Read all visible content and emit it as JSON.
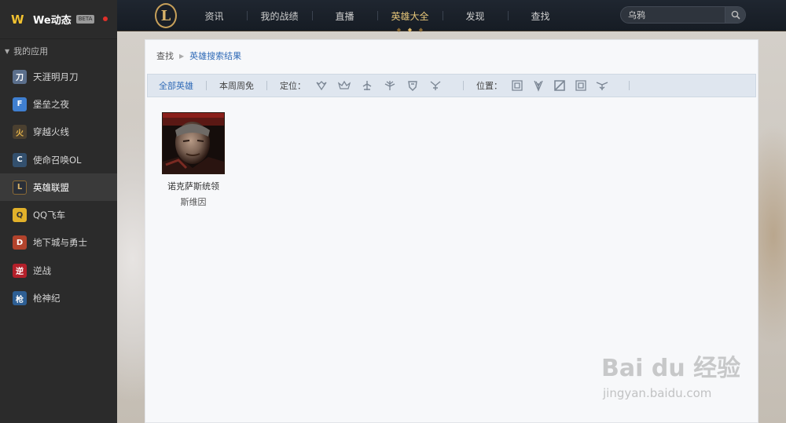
{
  "sidebar": {
    "app_name": "We动态",
    "beta_badge": "BETA",
    "section_label": "我的应用",
    "items": [
      {
        "label": "天涯明月刀",
        "icon": "tianya-icon",
        "color": "#5b6f8c",
        "glyph": "刀"
      },
      {
        "label": "堡垒之夜",
        "icon": "fortnite-icon",
        "color": "#3f7fd0",
        "glyph": "F"
      },
      {
        "label": "穿越火线",
        "icon": "crossfire-icon",
        "color": "#4b4030",
        "glyph": "火"
      },
      {
        "label": "使命召唤OL",
        "icon": "cod-icon",
        "color": "#33506e",
        "glyph": "C"
      },
      {
        "label": "英雄联盟",
        "icon": "lol-icon",
        "color": "#2a2f38",
        "glyph": "L"
      },
      {
        "label": "QQ飞车",
        "icon": "qqspeed-icon",
        "color": "#e2b12a",
        "glyph": "Q"
      },
      {
        "label": "地下城与勇士",
        "icon": "dnf-icon",
        "color": "#b2432c",
        "glyph": "D"
      },
      {
        "label": "逆战",
        "icon": "nizhan-icon",
        "color": "#b3202a",
        "glyph": "逆"
      },
      {
        "label": "枪神纪",
        "icon": "qiangshen-icon",
        "color": "#2e5f94",
        "glyph": "枪"
      }
    ],
    "active_index": 4
  },
  "topnav": {
    "logo_letter": "L",
    "items": [
      "资讯",
      "我的战绩",
      "直播",
      "英雄大全",
      "发现",
      "查找"
    ],
    "active_index": 3,
    "search": {
      "value": "乌鸦",
      "placeholder": "乌鸦"
    }
  },
  "breadcrumb": {
    "root": "查找",
    "current": "英雄搜索结果"
  },
  "filters": {
    "tabs": [
      "全部英雄",
      "本周周免"
    ],
    "role_label": "定位：",
    "role_icons": [
      "assassin-icon",
      "mage-icon",
      "tank-icon",
      "marksman-icon",
      "fighter-icon",
      "support-icon"
    ],
    "position_label": "位置：",
    "position_icons": [
      "top-lane-icon",
      "jungle-icon",
      "mid-lane-icon",
      "bot-lane-icon",
      "support-lane-icon"
    ]
  },
  "results": [
    {
      "name": "诺克萨斯统领",
      "title": "斯维因"
    }
  ],
  "watermark": {
    "brand": "Bai du 经验",
    "url": "jingyan.baidu.com"
  },
  "colors": {
    "accent": "#2f6ab7",
    "nav_active": "#e8c77a",
    "sidebar_bg": "#2b2b2b"
  }
}
